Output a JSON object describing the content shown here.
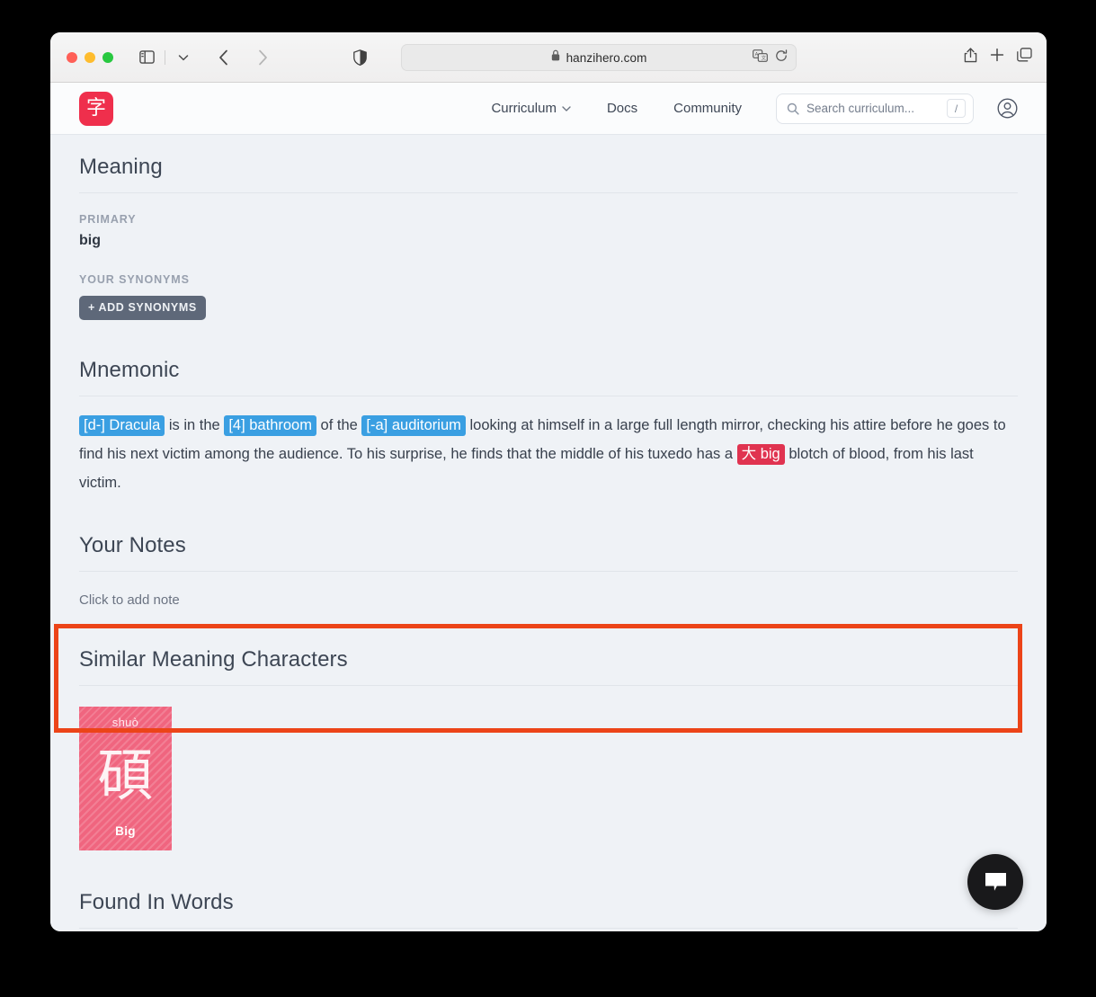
{
  "browser": {
    "url": "hanzihero.com",
    "lock_icon": "lock-icon",
    "sidebar_icon": "sidebar-toggle-icon",
    "tab_menu_icon": "chevron-down-icon",
    "back_icon": "back-arrow-icon",
    "forward_icon": "forward-arrow-icon",
    "shield_icon": "privacy-shield-icon",
    "translate_icon": "translate-icon",
    "reload_icon": "reload-icon",
    "share_icon": "share-icon",
    "new_tab_icon": "plus-icon",
    "tabs_icon": "tab-overview-icon"
  },
  "header": {
    "logo_char": "字",
    "nav": [
      {
        "label": "Curriculum",
        "has_chevron": true
      },
      {
        "label": "Docs",
        "has_chevron": false
      },
      {
        "label": "Community",
        "has_chevron": false
      }
    ],
    "search": {
      "placeholder": "Search curriculum...",
      "shortcut": "/",
      "icon": "search-icon"
    },
    "account_icon": "account-circle-icon"
  },
  "meaning": {
    "title": "Meaning",
    "primary_label": "PRIMARY",
    "primary_value": "big",
    "synonyms_label": "YOUR SYNONYMS",
    "add_synonyms_button": "+ ADD SYNONYMS"
  },
  "mnemonic": {
    "title": "Mnemonic",
    "parts": {
      "h1": "[d-] Dracula",
      "t1": " is in the ",
      "h2": "[4] bathroom",
      "t2": " of the ",
      "h3": "[-a] auditorium",
      "t3": " looking at himself in a large full length mirror, checking his attire before he goes to find his next victim among the audience. To his surprise, he finds that the middle of his tuxedo has a ",
      "h4_han": "大",
      "h4_gloss": "big",
      "t4": " blotch of blood, from his last victim."
    }
  },
  "notes": {
    "title": "Your Notes",
    "placeholder": "Click to add note",
    "highlight_color": "#ec4418"
  },
  "similar": {
    "title": "Similar Meaning Characters",
    "cards": [
      {
        "pinyin": "shuò",
        "hanzi": "碩",
        "meaning": "Big",
        "color": "#f0657f"
      }
    ]
  },
  "found_in_words": {
    "title": "Found In Words",
    "strip_color": "#a43fd6"
  },
  "chat": {
    "icon": "chat-bubble-icon"
  }
}
